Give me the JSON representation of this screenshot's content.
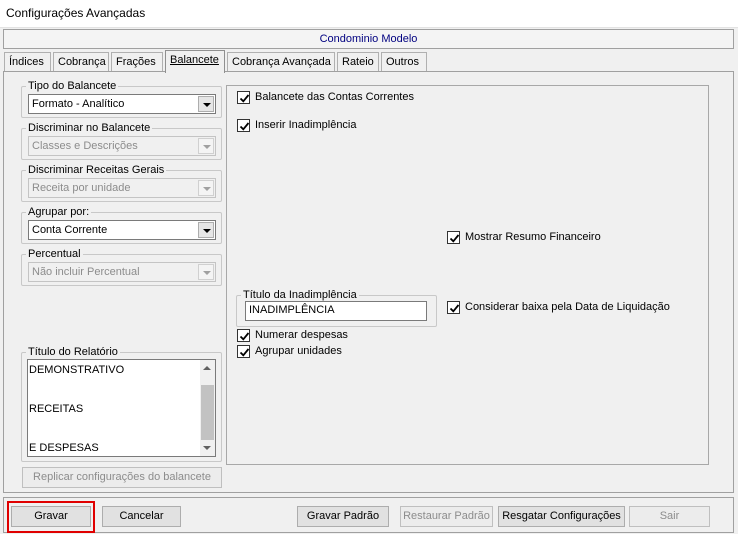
{
  "window": {
    "title": "Configurações Avançadas"
  },
  "header": {
    "title": "Condominio Modelo"
  },
  "tabs": [
    {
      "label": "Índices"
    },
    {
      "label": "Cobrança"
    },
    {
      "label": "Frações"
    },
    {
      "label": "Balancete"
    },
    {
      "label": "Cobrança Avançada"
    },
    {
      "label": "Rateio"
    },
    {
      "label": "Outros"
    }
  ],
  "left": {
    "tipo_balancete": {
      "legend": "Tipo do Balancete",
      "value": "Formato - Analítico"
    },
    "discriminar_balancete": {
      "legend": "Discriminar no Balancete",
      "value": "Classes e Descrições"
    },
    "discriminar_receitas": {
      "legend": "Discriminar Receitas Gerais",
      "value": "Receita por unidade"
    },
    "agrupar_por": {
      "legend": "Agrupar por:",
      "value": "Conta Corrente"
    },
    "percentual": {
      "legend": "Percentual",
      "value": "Não incluir Percentual"
    },
    "titulo_relatorio": {
      "legend": "Título do Relatório",
      "lines": [
        "DEMONSTRATIVO",
        "RECEITAS",
        "E DESPESAS"
      ]
    },
    "replicar_button": "Replicar configurações do balancete"
  },
  "right": {
    "chk_balancete_contas": "Balancete das Contas Correntes",
    "chk_inserir_inadimplencia": "Inserir Inadimplência",
    "chk_mostrar_resumo": "Mostrar Resumo Financeiro",
    "titulo_inadimplencia": {
      "legend": "Título da Inadimplência",
      "value": "INADIMPLÊNCIA"
    },
    "chk_considerar_baixa": "Considerar baixa pela Data de Liquidação",
    "chk_numerar_despesas": "Numerar despesas",
    "chk_agrupar_unidades": "Agrupar unidades"
  },
  "buttons": {
    "gravar": "Gravar",
    "cancelar": "Cancelar",
    "gravar_padrao": "Gravar Padrão",
    "restaurar_padrao": "Restaurar Padrão",
    "resgatar": "Resgatar Configurações",
    "sair": "Sair"
  },
  "colors": {
    "highlight": "#e00000",
    "header_text": "#000080"
  }
}
